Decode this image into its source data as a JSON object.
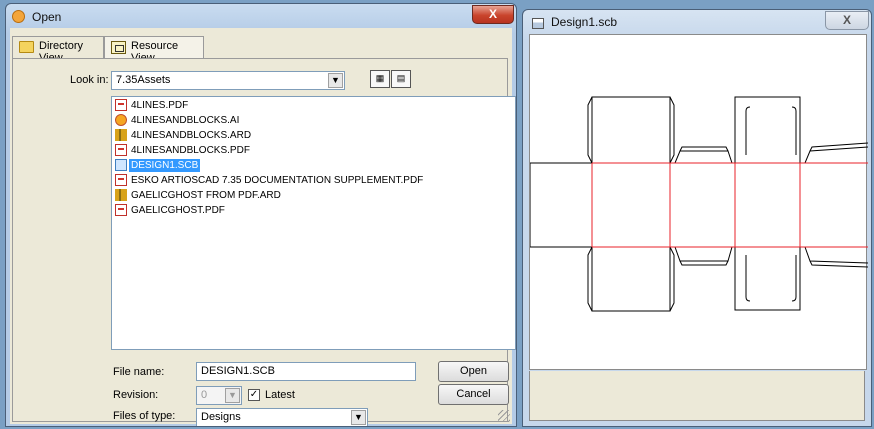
{
  "open_dialog": {
    "title": "Open",
    "close_label": "X",
    "tabs": [
      {
        "label": "Directory View"
      },
      {
        "label": "Resource View"
      }
    ],
    "look_in": {
      "label": "Look in:",
      "value": "7.35Assets"
    },
    "files": [
      {
        "name": "4LINES.PDF",
        "icon": "pdf-icon"
      },
      {
        "name": "4LINESANDBLOCKS.AI",
        "icon": "illustrator-icon"
      },
      {
        "name": "4LINESANDBLOCKS.ARD",
        "icon": "artioscad-icon"
      },
      {
        "name": "4LINESANDBLOCKS.PDF",
        "icon": "pdf-icon"
      },
      {
        "name": "DESIGN1.SCB",
        "icon": "scb-icon",
        "selected": true
      },
      {
        "name": "ESKO ARTIOSCAD 7.35 DOCUMENTATION SUPPLEMENT.PDF",
        "icon": "pdf-icon"
      },
      {
        "name": "GAELICGHOST FROM PDF.ARD",
        "icon": "artioscad-icon"
      },
      {
        "name": "GAELICGHOST.PDF",
        "icon": "pdf-icon"
      }
    ],
    "file_name": {
      "label": "File name:",
      "value": "DESIGN1.SCB"
    },
    "revision": {
      "label": "Revision:",
      "value": "0",
      "latest_label": "Latest",
      "latest_checked": true
    },
    "files_of_type": {
      "label": "Files of type:",
      "value": "Designs"
    },
    "open_button": "Open",
    "cancel_button": "Cancel"
  },
  "preview": {
    "title": "Design1.scb",
    "close_label": "X",
    "colors": {
      "cut_line": "#000000",
      "crease_line": "#e8202a"
    }
  }
}
